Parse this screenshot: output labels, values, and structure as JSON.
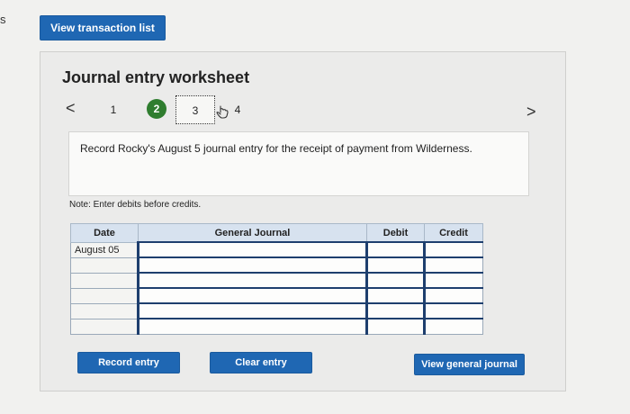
{
  "edge_letter": "s",
  "top_button": "View transaction list",
  "worksheet": {
    "title": "Journal entry worksheet",
    "nav": {
      "prev": "<",
      "next": ">"
    },
    "steps": [
      "1",
      "2",
      "3",
      "4"
    ],
    "active_step": "2",
    "focused_step": "3",
    "instruction": "Record Rocky's August 5 journal entry for the receipt of payment from Wilderness.",
    "note": "Note: Enter debits before credits.",
    "table": {
      "headers": {
        "date": "Date",
        "journal": "General Journal",
        "debit": "Debit",
        "credit": "Credit"
      },
      "rows": [
        {
          "date": "August 05",
          "journal": "",
          "debit": "",
          "credit": ""
        },
        {
          "date": "",
          "journal": "",
          "debit": "",
          "credit": ""
        },
        {
          "date": "",
          "journal": "",
          "debit": "",
          "credit": ""
        },
        {
          "date": "",
          "journal": "",
          "debit": "",
          "credit": ""
        },
        {
          "date": "",
          "journal": "",
          "debit": "",
          "credit": ""
        },
        {
          "date": "",
          "journal": "",
          "debit": "",
          "credit": ""
        }
      ]
    },
    "buttons": {
      "record": "Record entry",
      "clear": "Clear entry",
      "view_journal": "View general journal"
    }
  },
  "colors": {
    "accent_blue": "#1f67b3",
    "step_active": "#2f7d2f",
    "table_header": "#d7e2ef"
  }
}
